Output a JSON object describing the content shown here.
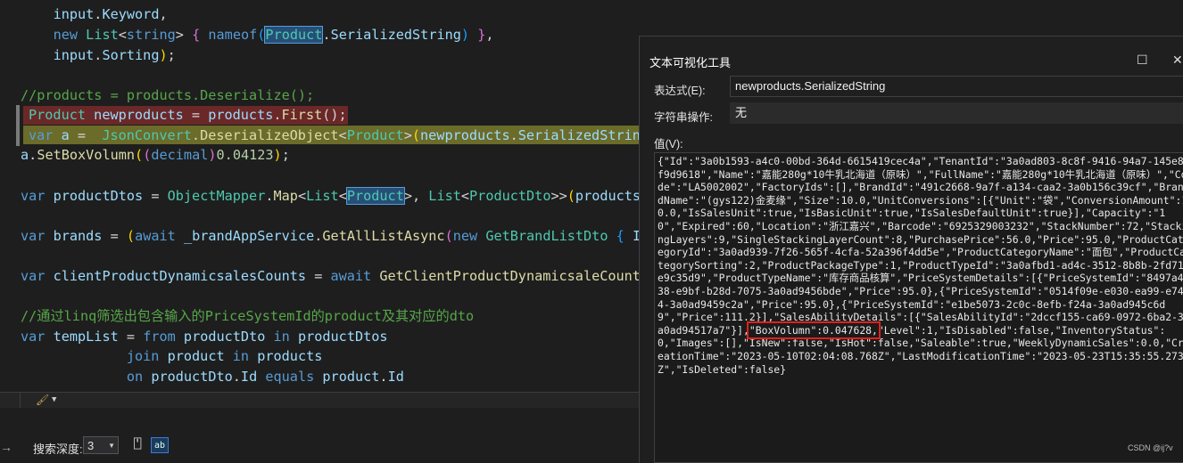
{
  "editor": {
    "lines": [
      [
        "    input.Keyword,"
      ],
      [
        "    new List<string> { nameof(Product.SerializedString) },"
      ],
      [
        "    input.Sorting);"
      ],
      [
        "//products = products.Deserialize();"
      ],
      [
        "Product newproducts = products.First();"
      ],
      [
        "var a =  JsonConvert.DeserializeObject<Product>(newproducts.SerializedStrin"
      ],
      [
        "a.SetBoxVolumn((decimal)0.04123);"
      ],
      [
        "var productDtos = ObjectMapper.Map<List<Product>, List<ProductDto>>(products"
      ],
      [
        "var brands = (await _brandAppService.GetAllListAsync(new GetBrandListDto { I"
      ],
      [
        "var clientProductDynamicsalesCounts = await GetClientProductDynamicsaleCount"
      ],
      [
        "//通过linq筛选出包含输入的PriceSystemId的product及其对应的dto"
      ],
      [
        "var tempList = from productDto in productDtos"
      ],
      [
        "               join product in products"
      ],
      [
        "               on productDto.Id equals product.Id"
      ]
    ],
    "tokens": {
      "input": "input",
      "Keyword": "Keyword",
      "new": "new",
      "List": "List",
      "string": "string",
      "nameof": "nameof",
      "Product": "Product",
      "SerializedString": "SerializedString",
      "Sorting": "Sorting",
      "comment1": "//products = products.Deserialize();",
      "newproducts": "newproducts",
      "products": "products",
      "First": "First",
      "var": "var",
      "a": "a",
      "JsonConvert": "JsonConvert",
      "DeserializeObject": "DeserializeObject",
      "SerializedStrin": "SerializedStrin",
      "SetBoxVolumn": "SetBoxVolumn",
      "decimal": "decimal",
      "num": "0.04123",
      "productDtos": "productDtos",
      "ObjectMapper": "ObjectMapper",
      "Map": "Map",
      "ProductDto": "ProductDto",
      "brands": "brands",
      "await": "await",
      "brandAppService": "_brandAppService",
      "GetAllListAsync": "GetAllListAsync",
      "GetBrandListDto": "GetBrandListDto",
      "I": "I",
      "clientCounts": "clientProductDynamicsalesCounts",
      "GetCount": "GetClientProductDynamicsaleCount",
      "comment2": "//通过linq筛选出包含输入的PriceSystemId的product及其对应的dto",
      "tempList": "tempList",
      "from": "from",
      "productDto": "productDto",
      "in": "in",
      "join": "join",
      "product": "product",
      "on": "on",
      "Id": "Id",
      "equals": "equals"
    }
  },
  "bottom": {
    "search_depth_label": "搜索深度:",
    "search_depth_value": "3"
  },
  "dialog": {
    "title": "文本可视化工具",
    "expression_label": "表达式(E):",
    "expression_value": "newproducts.SerializedString",
    "string_op_label": "字符串操作:",
    "string_op_value": "无",
    "value_label": "值(V):",
    "value_before": "{\"Id\":\"3a0b1593-a4c0-00bd-364d-6615419cec4a\",\"TenantId\":\"3a0ad803-8c8f-9416-94a7-145e8f9d9618\",\"Name\":\"嘉能280g*10牛乳北海道（原味）\",\"FullName\":\"嘉能280g*10牛乳北海道（原味）\",\"Code\":\"LA5002002\",\"FactoryIds\":[],\"BrandId\":\"491c2668-9a7f-a134-caa2-3a0b156c39cf\",\"BrandName\":\"(gys122)金麦缘\",\"Size\":10.0,\"UnitConversions\":[{\"Unit\":\"袋\",\"ConversionAmount\":10.0,\"IsSalesUnit\":true,\"IsBasicUnit\":true,\"IsSalesDefaultUnit\":true}],\"Capacity\":\"10\",\"Expired\":60,\"Location\":\"浙江嘉兴\",\"Barcode\":\"6925329003232\",\"StackNumber\":72,\"StackingLayers\":9,\"SingleStackingLayerCount\":8,\"PurchasePrice\":56.0,\"Price\":95.0,\"ProductCategoryId\":\"3a0ad939-7f26-565f-4cfa-52a396f4dd5e\",\"ProductCategoryName\":\"面包\",\"ProductCategorySorting\":2,\"ProductPackageType\":1,\"ProductTypeId\":\"3a0afbd1-ad4c-3512-8b8b-2fd71e9c35d9\",\"ProductTypeName\":\"库存商品核算\",\"PriceSystemDetails\":[{\"PriceSystemId\":\"8497a438-e9bf-b28d-7075-3a0ad9456bde\",\"Price\":95.0},{\"PriceSystemId\":\"0514f09e-e030-ea99-e744-3a0ad9459c2a\",\"Price\":95.0},{\"PriceSystemId\":\"e1be5073-2c0c-8efb-f24a-3a0ad945c6d9\",\"Price\":111.2}],\"SalesAbilityDetails\":[{\"SalesAbilityId\":\"2dccf155-ca69-0972-6ba2-3a0ad94517a7\"}],",
    "value_highlight": "\"BoxVolumn\":0.047628,",
    "value_after": "\"Level\":1,\"IsDisabled\":false,\"InventoryStatus\":0,\"Images\":[],\"IsNew\":false,\"IsHot\":false,\"Saleable\":true,\"WeeklyDynamicSales\":0.0,\"CreationTime\":\"2023-05-10T02:04:08.768Z\",\"LastModificationTime\":\"2023-05-23T15:35:55.273Z\",\"IsDeleted\":false}"
  },
  "watermark": "CSDN @ij?v",
  "colors": {
    "highlight_box": "#e0201b",
    "red_line": "#6b2828",
    "yellow_line": "#6b6b2a"
  }
}
